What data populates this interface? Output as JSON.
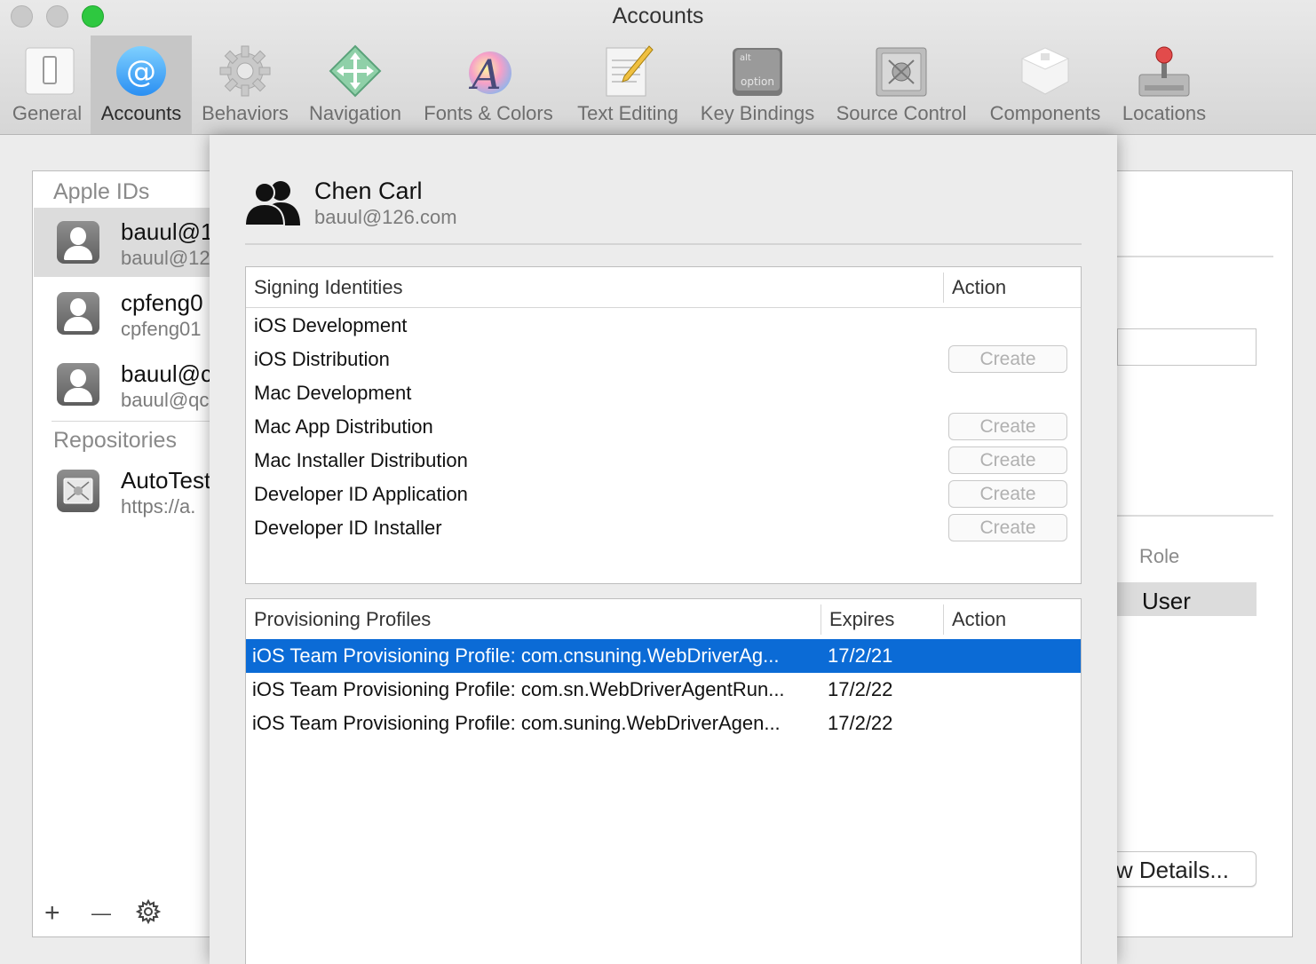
{
  "window": {
    "title": "Accounts"
  },
  "toolbar": {
    "tabs": [
      {
        "label": "General",
        "icon": "switch-icon",
        "active": false
      },
      {
        "label": "Accounts",
        "icon": "at-sign-icon",
        "active": true
      },
      {
        "label": "Behaviors",
        "icon": "gear-icon",
        "active": false
      },
      {
        "label": "Navigation",
        "icon": "move-arrows-icon",
        "active": false
      },
      {
        "label": "Fonts & Colors",
        "icon": "font-colors-icon",
        "active": false
      },
      {
        "label": "Text Editing",
        "icon": "pencil-paper-icon",
        "active": false
      },
      {
        "label": "Key Bindings",
        "icon": "option-key-icon",
        "active": false
      },
      {
        "label": "Source Control",
        "icon": "safe-icon",
        "active": false
      },
      {
        "label": "Components",
        "icon": "box-icon",
        "active": false
      },
      {
        "label": "Locations",
        "icon": "joystick-drive-icon",
        "active": false
      }
    ],
    "key_icon_top": "alt",
    "key_icon_bottom": "option"
  },
  "sidebar": {
    "apple_ids_title": "Apple IDs",
    "accounts": [
      {
        "name": "bauul@1",
        "sub": "bauul@12",
        "selected": true
      },
      {
        "name": "cpfeng0",
        "sub": "cpfeng01",
        "selected": false
      },
      {
        "name": "bauul@c",
        "sub": "bauul@qc",
        "selected": false
      }
    ],
    "repositories_title": "Repositories",
    "repositories": [
      {
        "name": "AutoTest",
        "sub": "https://a."
      }
    ],
    "add_label": "+",
    "remove_label": "—"
  },
  "right_panel": {
    "role_header": "Role",
    "role_value": "User",
    "details_button": "View Details..."
  },
  "sheet": {
    "user": {
      "name": "Chen Carl",
      "email": "bauul@126.com"
    },
    "signing": {
      "header_name": "Signing Identities",
      "header_action": "Action",
      "rows": [
        {
          "name": "iOS Development",
          "action": ""
        },
        {
          "name": "iOS Distribution",
          "action": "Create"
        },
        {
          "name": "Mac Development",
          "action": ""
        },
        {
          "name": "Mac App Distribution",
          "action": "Create"
        },
        {
          "name": "Mac Installer Distribution",
          "action": "Create"
        },
        {
          "name": "Developer ID Application",
          "action": "Create"
        },
        {
          "name": "Developer ID Installer",
          "action": "Create"
        }
      ]
    },
    "profiles": {
      "header_name": "Provisioning Profiles",
      "header_expires": "Expires",
      "header_action": "Action",
      "rows": [
        {
          "name": "iOS Team Provisioning Profile: com.cnsuning.WebDriverAg...",
          "expires": "17/2/21",
          "selected": true
        },
        {
          "name": "iOS Team Provisioning Profile: com.sn.WebDriverAgentRun...",
          "expires": "17/2/22",
          "selected": false
        },
        {
          "name": "iOS Team Provisioning Profile: com.suning.WebDriverAgen...",
          "expires": "17/2/22",
          "selected": false
        }
      ]
    }
  },
  "colors": {
    "accent": "#0b6bd6",
    "close": "#c9c9c9",
    "zoom": "#2ec840"
  }
}
